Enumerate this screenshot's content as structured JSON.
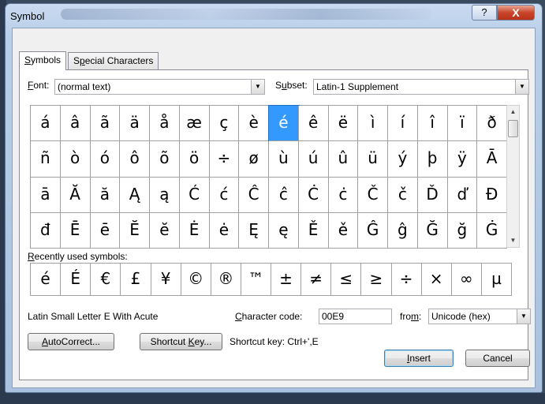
{
  "window": {
    "title": "Symbol",
    "help_glyph": "?",
    "close_glyph": "X"
  },
  "tabs": [
    {
      "pre": "",
      "acc": "S",
      "post": "ymbols"
    },
    {
      "pre": "S",
      "acc": "p",
      "post": "ecial Characters"
    }
  ],
  "font": {
    "label_acc": "F",
    "label_rest": "ont:",
    "value": "(normal text)"
  },
  "subset": {
    "label_pre": "S",
    "label_acc": "u",
    "label_post": "bset:",
    "value": "Latin-1 Supplement"
  },
  "grid_rows": [
    [
      "á",
      "â",
      "ã",
      "ä",
      "å",
      "æ",
      "ç",
      "è",
      "é",
      "ê",
      "ë",
      "ì",
      "í",
      "î",
      "ï",
      "ð"
    ],
    [
      "ñ",
      "ò",
      "ó",
      "ô",
      "õ",
      "ö",
      "÷",
      "ø",
      "ù",
      "ú",
      "û",
      "ü",
      "ý",
      "þ",
      "ÿ",
      "Ā"
    ],
    [
      "ā",
      "Ă",
      "ă",
      "Ą",
      "ą",
      "Ć",
      "ć",
      "Ĉ",
      "ĉ",
      "Ċ",
      "ċ",
      "Č",
      "č",
      "Ď",
      "ď",
      "Đ"
    ],
    [
      "đ",
      "Ē",
      "ē",
      "Ĕ",
      "ĕ",
      "Ė",
      "ė",
      "Ę",
      "ę",
      "Ě",
      "ě",
      "Ĝ",
      "ĝ",
      "Ğ",
      "ğ",
      "Ġ"
    ]
  ],
  "selected_symbol": "é",
  "recent": {
    "label_acc": "R",
    "label_rest": "ecently used symbols:",
    "symbols": [
      "é",
      "É",
      "€",
      "£",
      "¥",
      "©",
      "®",
      "™",
      "±",
      "≠",
      "≤",
      "≥",
      "÷",
      "×",
      "∞",
      "µ"
    ]
  },
  "char_name": "Latin Small Letter E With Acute",
  "char_code": {
    "label_acc": "C",
    "label_rest": "haracter code:",
    "value": "00E9"
  },
  "from": {
    "label_pre": "fro",
    "label_acc": "m",
    "label_post": ":",
    "value": "Unicode (hex)"
  },
  "buttons": {
    "autocorrect": {
      "acc": "A",
      "rest": "utoCorrect..."
    },
    "shortcut_key": {
      "pre": "Shortcut ",
      "acc": "K",
      "post": "ey..."
    },
    "insert": {
      "acc": "I",
      "rest": "nsert"
    },
    "cancel": "Cancel"
  },
  "shortcut_text": "Shortcut key: Ctrl+',E"
}
